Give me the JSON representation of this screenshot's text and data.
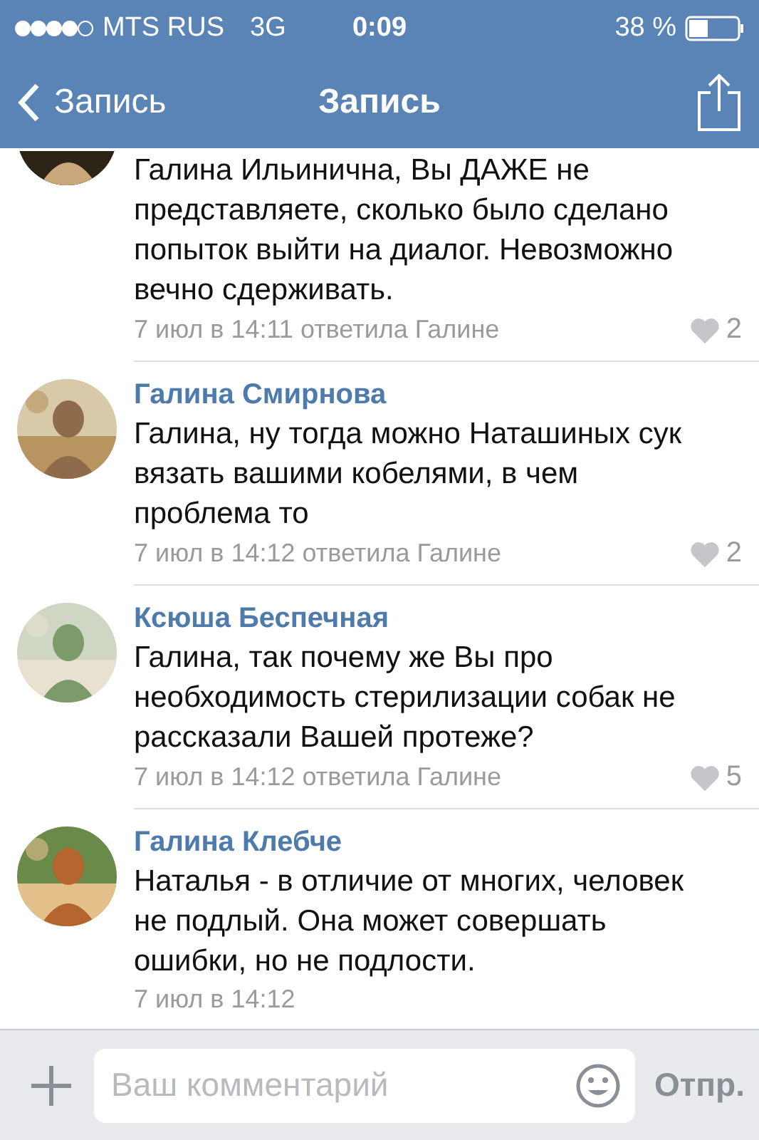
{
  "status_bar": {
    "carrier": "MTS RUS",
    "network": "3G",
    "time": "0:09",
    "battery": "38 %"
  },
  "nav": {
    "back": "Запись",
    "title": "Запись"
  },
  "comments": [
    {
      "text": "Галина Ильинична, Вы ДАЖЕ не представляете, сколько было сделано попыток выйти на диалог. Невозможно вечно сдерживать.",
      "meta": "7 июл в 14:11 ответила Галине",
      "likes": "2"
    },
    {
      "author": "Галина Смирнова",
      "text": "Галина, ну тогда можно Наташиных сук вязать вашими кобелями, в чем проблема то",
      "meta": "7 июл в 14:12 ответила Галине",
      "likes": "2"
    },
    {
      "author": "Ксюша Беспечная",
      "text": "Галина, так почему же Вы про необходимость стерилизации собак не рассказали Вашей протеже?",
      "meta": "7 июл в 14:12 ответила Галине",
      "likes": "5"
    },
    {
      "author": "Галина Клебче",
      "text": "Наталья - в отличие от многих, человек не подлый. Она может совершать ошибки, но не подлости.",
      "meta": "7 июл в 14:12"
    }
  ],
  "composer": {
    "placeholder": "Ваш комментарий",
    "send": "Отпр."
  }
}
